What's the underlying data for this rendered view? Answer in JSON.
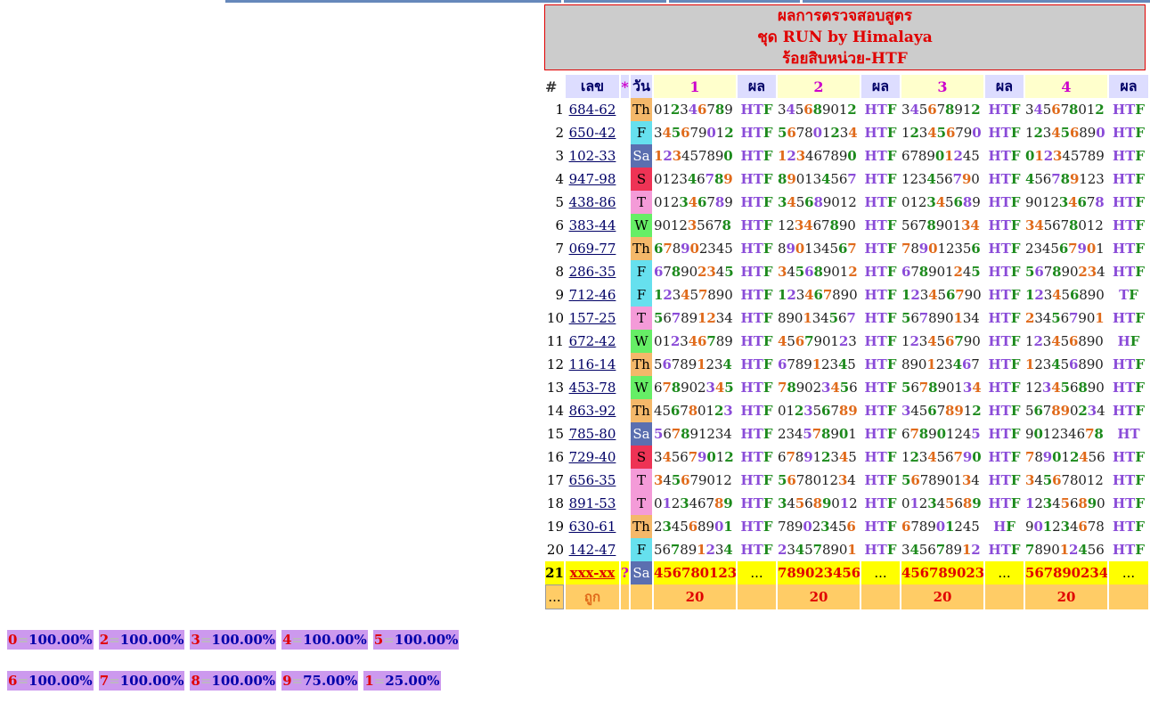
{
  "title": {
    "line1": "ผลการตรวจสอบสูตร",
    "line2": "ชุด RUN by Himalaya",
    "line3": "ร้อยสิบหน่วย-HTF"
  },
  "headers": {
    "num": "#",
    "lek": "เลข",
    "star": "*",
    "day": "วัน",
    "sets": [
      "1",
      "2",
      "3",
      "4"
    ],
    "result": "ผล"
  },
  "day_colors": {
    "Th": "#f4b86a",
    "F": "#66e0ee",
    "Sa": "#5b6fb0",
    "S": "#ee3355",
    "T": "#f49bd8",
    "W": "#66ee66"
  },
  "rows": [
    {
      "n": "1",
      "lek": "684-62",
      "day": "Th",
      "s": [
        "0123467890",
        "3456890120",
        "3456789120",
        "3456780120"
      ],
      "r": [
        "HTF",
        "HTF",
        "HTF",
        "HTF"
      ]
    },
    {
      "n": "2",
      "lek": "650-42",
      "day": "F",
      "s": [
        "3456790120",
        "5678012340",
        "1234567900",
        "1234568900"
      ],
      "r": [
        "HTF",
        "HTF",
        "HTF",
        "HTF"
      ]
    },
    {
      "n": "3",
      "lek": "102-33",
      "day": "Sa",
      "s": [
        "1234578900",
        "1234678900",
        "6789012450",
        "0123457890"
      ],
      "r": [
        "HTF",
        "HTF",
        "HTF",
        "HTF"
      ]
    },
    {
      "n": "4",
      "lek": "947-98",
      "day": "S",
      "s": [
        "0123467890",
        "8901345670",
        "1234567900",
        "4567891230"
      ],
      "r": [
        "HTF",
        "HTF",
        "HTF",
        "HTF"
      ]
    },
    {
      "n": "5",
      "lek": "438-86",
      "day": "T",
      "s": [
        "0123467890",
        "3456890120",
        "0123456890",
        "9012346780"
      ],
      "r": [
        "HTF",
        "HTF",
        "HTF",
        "HTF"
      ]
    },
    {
      "n": "6",
      "lek": "383-44",
      "day": "W",
      "s": [
        "9012356780",
        "1234678900",
        "5678901340",
        "3456780120"
      ],
      "r": [
        "HTF",
        "HTF",
        "HTF",
        "HTF"
      ]
    },
    {
      "n": "7",
      "lek": "069-77",
      "day": "Th",
      "s": [
        "6789023450",
        "8901345670",
        "7890123560",
        "2345679010"
      ],
      "r": [
        "HTF",
        "HTF",
        "HTF",
        "HTF"
      ]
    },
    {
      "n": "8",
      "lek": "286-35",
      "day": "F",
      "s": [
        "6789023450",
        "3456890120",
        "6789012450",
        "5678902340"
      ],
      "r": [
        "HTF",
        "HTF",
        "HTF",
        "HTF"
      ]
    },
    {
      "n": "9",
      "lek": "712-46",
      "day": "F",
      "s": [
        "1234578900",
        "1234678900",
        "1234567900",
        "1234568900"
      ],
      "r": [
        "HTF",
        "HTF",
        "HTF",
        "TF"
      ]
    },
    {
      "n": "10",
      "lek": "157-25",
      "day": "T",
      "s": [
        "5678912340",
        "8901345670",
        "5678901340",
        "2345679010"
      ],
      "r": [
        "HTF",
        "HTF",
        "HTF",
        "HTF"
      ]
    },
    {
      "n": "11",
      "lek": "672-42",
      "day": "W",
      "s": [
        "0123467890",
        "4567901230",
        "1234567900",
        "1234568900"
      ],
      "r": [
        "HTF",
        "HTF",
        "HTF",
        "HF"
      ]
    },
    {
      "n": "12",
      "lek": "116-14",
      "day": "Th",
      "s": [
        "5678912340",
        "6789123450",
        "8901234670",
        "1234568900"
      ],
      "r": [
        "HTF",
        "HTF",
        "HTF",
        "HTF"
      ]
    },
    {
      "n": "13",
      "lek": "453-78",
      "day": "W",
      "s": [
        "6789023450",
        "7890234560",
        "5678901340",
        "1234568900"
      ],
      "r": [
        "HTF",
        "HTF",
        "HTF",
        "HTF"
      ]
    },
    {
      "n": "14",
      "lek": "863-92",
      "day": "Th",
      "s": [
        "4567801230",
        "0123567890",
        "3456789120",
        "5678902340"
      ],
      "r": [
        "HTF",
        "HTF",
        "HTF",
        "HTF"
      ]
    },
    {
      "n": "15",
      "lek": "785-80",
      "day": "Sa",
      "s": [
        "5678912340",
        "2345789010",
        "6789012450",
        "9012346780"
      ],
      "r": [
        "HTF",
        "HTF",
        "HTF",
        "HT"
      ]
    },
    {
      "n": "16",
      "lek": "729-40",
      "day": "S",
      "s": [
        "3456790120",
        "6789123450",
        "1234567900",
        "7890124560"
      ],
      "r": [
        "HTF",
        "HTF",
        "HTF",
        "HTF"
      ]
    },
    {
      "n": "17",
      "lek": "656-35",
      "day": "T",
      "s": [
        "3456790120",
        "5678012340",
        "5678901340",
        "3456780120"
      ],
      "r": [
        "HTF",
        "HTF",
        "HTF",
        "HTF"
      ]
    },
    {
      "n": "18",
      "lek": "891-53",
      "day": "T",
      "s": [
        "0123467890",
        "3456890120",
        "0123456890",
        "1234568900"
      ],
      "r": [
        "HTF",
        "HTF",
        "HTF",
        "HTF"
      ]
    },
    {
      "n": "19",
      "lek": "630-61",
      "day": "Th",
      "s": [
        "2345689010",
        "7890234560",
        "6789012450",
        "9012346780"
      ],
      "r": [
        "HTF",
        "HTF",
        "HF",
        "HTF"
      ]
    },
    {
      "n": "20",
      "lek": "142-47",
      "day": "F",
      "s": [
        "5678912340",
        "2345789010",
        "3456789120",
        "7890124560"
      ],
      "r": [
        "HTF",
        "HTF",
        "HTF",
        "HTF"
      ]
    }
  ],
  "last_row": {
    "n": "21",
    "lek": "xxx-xx",
    "star": "?",
    "day": "Sa",
    "s": [
      "456780123",
      "789023456",
      "456789023",
      "567890234"
    ],
    "r": [
      "...",
      "...",
      "...",
      "..."
    ]
  },
  "summary_row": {
    "n": "...",
    "label": "ถูก",
    "counts": [
      "20",
      "20",
      "20",
      "20"
    ]
  },
  "stats_row1": [
    {
      "digit": "0",
      "eq": "=",
      "pct": "100.00%"
    },
    {
      "digit": "2",
      "eq": "=",
      "pct": "100.00%"
    },
    {
      "digit": "3",
      "eq": "=",
      "pct": "100.00%"
    },
    {
      "digit": "4",
      "eq": "=",
      "pct": "100.00%"
    },
    {
      "digit": "5",
      "eq": "=",
      "pct": "100.00%"
    }
  ],
  "stats_row2": [
    {
      "digit": "6",
      "eq": "=",
      "pct": "100.00%"
    },
    {
      "digit": "7",
      "eq": "=",
      "pct": "100.00%"
    },
    {
      "digit": "8",
      "eq": "=",
      "pct": "100.00%"
    },
    {
      "digit": "9",
      "eq": "=",
      "pct": "75.00%"
    },
    {
      "digit": "1",
      "eq": "=",
      "pct": "25.00%"
    }
  ]
}
